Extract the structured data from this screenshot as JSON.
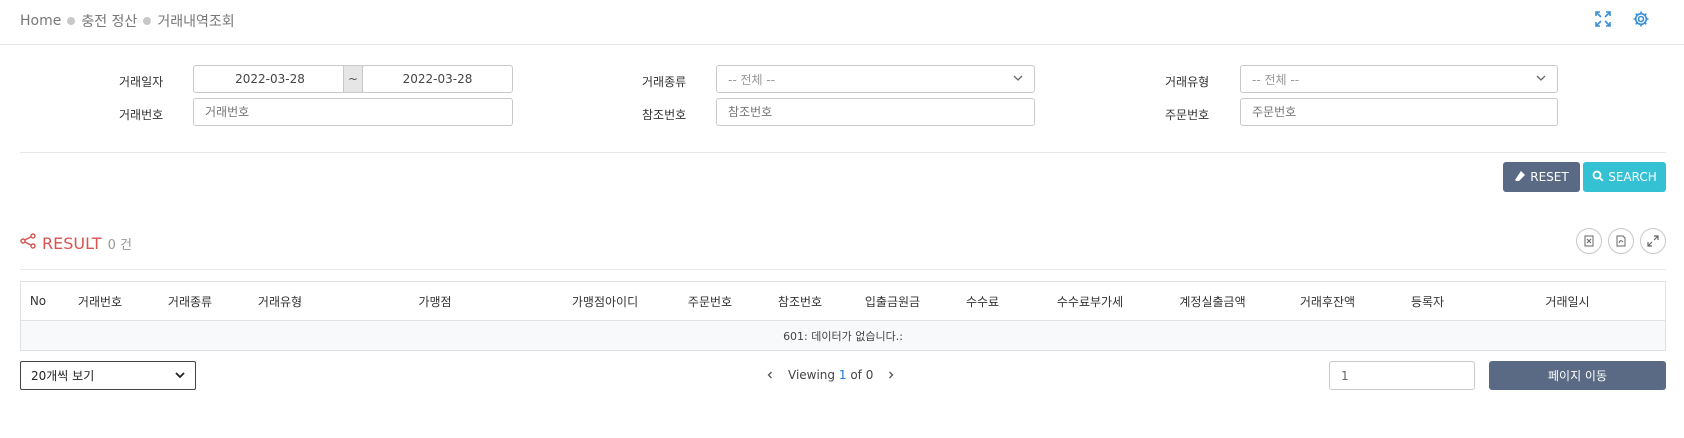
{
  "breadcrumb": {
    "items": [
      "Home",
      "충전 정산",
      "거래내역조회"
    ]
  },
  "filters": {
    "date_label": "거래일자",
    "date_from": "2022-03-28",
    "date_sep": "~",
    "date_to": "2022-03-28",
    "type_label": "거래종류",
    "type_value": "-- 전체 --",
    "kind_label": "거래유형",
    "kind_value": "-- 전체 --",
    "txno_label": "거래번호",
    "txno_placeholder": "거래번호",
    "ref_label": "참조번호",
    "ref_placeholder": "참조번호",
    "order_label": "주문번호",
    "order_placeholder": "주문번호"
  },
  "actions": {
    "reset_label": "RESET",
    "search_label": "SEARCH"
  },
  "result": {
    "title": "RESULT",
    "count": "0 건"
  },
  "table": {
    "columns": [
      "No",
      "거래번호",
      "거래종류",
      "거래유형",
      "가맹점",
      "가맹점아이디",
      "주문번호",
      "참조번호",
      "입출금원금",
      "수수료",
      "수수료부가세",
      "계정실출금액",
      "거래후잔액",
      "등록자",
      "거래일시"
    ],
    "empty_message": "601: 데이터가 없습니다.:"
  },
  "footer": {
    "page_size": "20개씩 보기",
    "viewing_label": "Viewing",
    "current_page": "1",
    "of_label": "of",
    "total_pages": "0",
    "page_input_value": "1",
    "move_label": "페이지 이동"
  },
  "colors": {
    "accent_red": "#d9534f",
    "reset_bg": "#5a6a85",
    "search_bg": "#35c1d4",
    "link_blue": "#1a7ad8"
  }
}
